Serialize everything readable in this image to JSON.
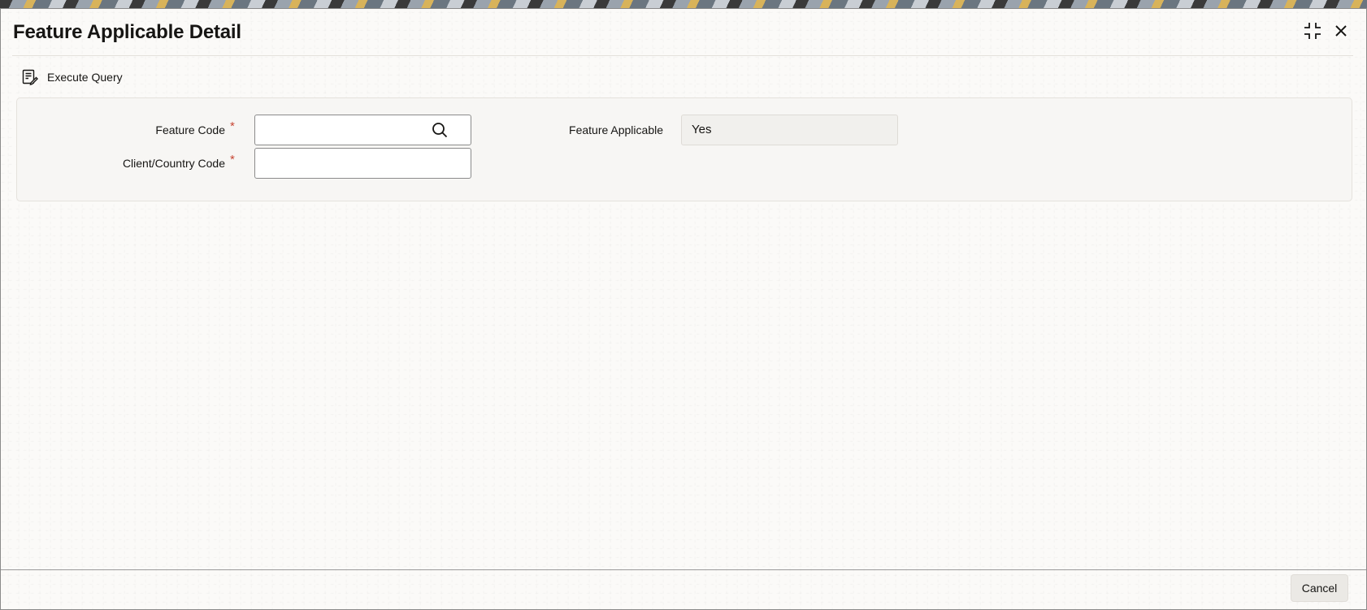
{
  "window": {
    "title": "Feature Applicable Detail"
  },
  "toolbar": {
    "execute_query_label": "Execute Query",
    "execute_query_icon": "execute-query-icon"
  },
  "form": {
    "feature_code": {
      "label": "Feature Code",
      "required_marker": "*",
      "value": "",
      "lookup_icon": "search-icon"
    },
    "client_country_code": {
      "label": "Client/Country Code",
      "required_marker": "*",
      "value": ""
    },
    "feature_applicable": {
      "label": "Feature Applicable",
      "value": "Yes"
    }
  },
  "footer": {
    "cancel_label": "Cancel"
  },
  "colors": {
    "required": "#c74634",
    "text": "#161513",
    "panel_bg": "#f7f6f4"
  }
}
